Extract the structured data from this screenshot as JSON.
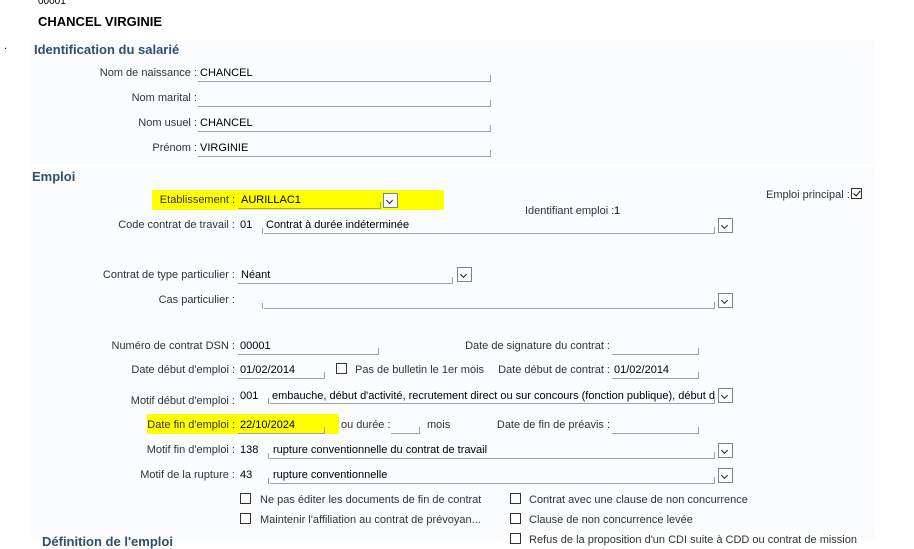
{
  "header": {
    "code": "00001",
    "name": "CHANCEL VIRGINIE"
  },
  "identification": {
    "title": "Identification du salarié",
    "nom_naissance": {
      "label": "Nom de naissance :",
      "value": "CHANCEL"
    },
    "nom_marital": {
      "label": "Nom marital :",
      "value": ""
    },
    "nom_usuel": {
      "label": "Nom usuel :",
      "value": "CHANCEL"
    },
    "prenom": {
      "label": "Prénom :",
      "value": "VIRGINIE"
    }
  },
  "emploi": {
    "title": "Emploi",
    "etablissement": {
      "label": "Etablissement :",
      "value": "AURILLAC1"
    },
    "emploi_principal": {
      "label": "Emploi principal :",
      "checked": true
    },
    "identifiant_emploi": {
      "label": "Identifiant emploi :",
      "value": "1"
    },
    "code_contrat": {
      "label": "Code contrat de travail :",
      "code": "01",
      "value": "Contrat à durée indéterminée"
    },
    "contrat_particulier": {
      "label": "Contrat de type particulier :",
      "value": "Néant"
    },
    "cas_particulier": {
      "label": "Cas particulier :",
      "value": ""
    },
    "numero_dsn": {
      "label": "Numéro de contrat DSN :",
      "value": "00001"
    },
    "date_signature": {
      "label": "Date de signature du contrat :",
      "value": ""
    },
    "date_debut_emploi": {
      "label": "Date début d'emploi :",
      "value": "01/02/2014"
    },
    "pas_bulletin": {
      "label": "Pas de bulletin le 1er mois",
      "checked": false
    },
    "date_debut_contrat": {
      "label": "Date début de contrat :",
      "value": "01/02/2014"
    },
    "motif_debut": {
      "label": "Motif début d'emploi :",
      "code": "001",
      "value": "embauche, début d'activité, recrutement direct ou sur concours (fonction publique), début de d"
    },
    "date_fin_emploi": {
      "label": "Date fin d'emploi :",
      "value": "22/10/2024"
    },
    "ou_duree": {
      "label": "ou durée :",
      "value": "",
      "unit": "mois"
    },
    "date_fin_preavis": {
      "label": "Date de fin de préavis :",
      "value": ""
    },
    "motif_fin": {
      "label": "Motif fin d'emploi :",
      "code": "138",
      "value": "rupture conventionnelle du contrat de travail"
    },
    "motif_rupture": {
      "label": "Motif de la rupture :",
      "code": "43",
      "value": "rupture conventionnelle"
    },
    "checkboxes": [
      {
        "label": "Ne pas éditer les documents de fin de contrat",
        "checked": false
      },
      {
        "label": "Contrat avec une clause de non concurrence",
        "checked": false
      },
      {
        "label": "Maintenir l'affiliation au contrat de prévoyan...",
        "checked": false
      },
      {
        "label": "Clause de non concurrence levée",
        "checked": false
      },
      {
        "label": "Refus de la proposition d'un CDI suite à CDD ou contrat de mission",
        "checked": false
      }
    ]
  },
  "next_section": {
    "title": "Définition de l'emploi"
  },
  "colors": {
    "highlight": "#ffff00",
    "section_title": "#2d4f72"
  }
}
